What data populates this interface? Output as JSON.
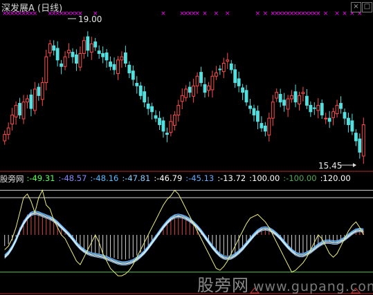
{
  "window": {
    "title": "深发展A (日线)",
    "buttons": [
      "×",
      "□"
    ]
  },
  "indicator_bar": {
    "name": "股旁网",
    "values": [
      {
        "text": ":-49.31",
        "color": "#55ff55"
      },
      {
        "text": ":-48.57",
        "color": "#8a8aff"
      },
      {
        "text": ":-48.16",
        "color": "#55bbff"
      },
      {
        "text": ":-47.81",
        "color": "#88ccff"
      },
      {
        "text": ":-46.79",
        "color": "#ffffff"
      },
      {
        "text": ":-45.13",
        "color": "#66aaff"
      },
      {
        "text": ":-13.72",
        "color": "#ffffff"
      },
      {
        "text": ":100.00",
        "color": "#ffffff"
      },
      {
        "text": ":-100.00",
        "color": "#55aa55"
      },
      {
        "text": ":120.00",
        "color": "#ffffff"
      }
    ]
  },
  "watermark": {
    "brand": "股旁网",
    "url": "www.gupang.com"
  },
  "annotations": {
    "high_label": "19.00",
    "low_label": "15.45"
  },
  "colors": {
    "up": "#ff4d4d",
    "down": "#55e0e0",
    "signal": "#ff00ff",
    "osc_white": "#ffffff",
    "osc_yellow": "#f0f080",
    "osc_blue": "#6fb4ff",
    "osc_cyan": "#8fdcff",
    "osc_green": "#55cc55",
    "bar_red": "#d84a4a",
    "bar_white": "#d8d8d8",
    "level_line": "#d8d8d8",
    "level_red": "#cc3333"
  },
  "chart_data": [
    {
      "type": "candlestick",
      "title": "深发展A (日线)",
      "series": [
        {
          "name": "close",
          "values": [
            16.0,
            16.2,
            16.6,
            16.9,
            16.6,
            17.0,
            17.1,
            16.8,
            17.4,
            17.2,
            17.6,
            18.4,
            18.8,
            18.6,
            18.3,
            18.1,
            18.4,
            18.6,
            18.4,
            18.2,
            18.5,
            18.9,
            18.6,
            18.8,
            18.7,
            18.5,
            18.4,
            18.3,
            18.1,
            18.0,
            18.3,
            18.4,
            18.2,
            17.9,
            17.7,
            17.5,
            17.2,
            17.0,
            16.8,
            16.7,
            16.5,
            16.3,
            16.1,
            16.0,
            16.4,
            16.6,
            16.9,
            17.2,
            17.4,
            17.3,
            17.5,
            17.8,
            17.6,
            17.3,
            17.5,
            17.8,
            17.9,
            18.0,
            18.2,
            18.3,
            18.0,
            17.6,
            17.5,
            17.3,
            17.0,
            16.8,
            16.6,
            16.4,
            16.2,
            16.1,
            16.5,
            17.0,
            17.3,
            17.0,
            16.9,
            17.1,
            17.2,
            17.0,
            17.2,
            17.3,
            16.9,
            16.7,
            16.8,
            16.9,
            16.6,
            16.5,
            16.4,
            16.7,
            16.9,
            16.8,
            16.5,
            16.3,
            16.1,
            15.8,
            15.45,
            16.3
          ]
        },
        {
          "name": "buy_signal_marks",
          "values": [
            1,
            1,
            1,
            1,
            1,
            1,
            1,
            1,
            1,
            0,
            0,
            0,
            1,
            1,
            1,
            1,
            1,
            1,
            1,
            1,
            1,
            0,
            0,
            0,
            1,
            0,
            0,
            0,
            0,
            0,
            0,
            0,
            0,
            0,
            0,
            0,
            0,
            0,
            0,
            0,
            0,
            0,
            1,
            0,
            0,
            0,
            0,
            1,
            1,
            1,
            1,
            1,
            0,
            1,
            0,
            0,
            1,
            0,
            0,
            1,
            0,
            0,
            0,
            0,
            0,
            0,
            0,
            1,
            0,
            1,
            0,
            1,
            1,
            1,
            1,
            1,
            1,
            1,
            1,
            1,
            1,
            1,
            1,
            1,
            0,
            1,
            0,
            0,
            1,
            0,
            1,
            0,
            1,
            0,
            1,
            0
          ]
        }
      ],
      "annotations": [
        {
          "text": "19.00",
          "type": "high"
        },
        {
          "text": "15.45",
          "type": "low"
        }
      ]
    },
    {
      "type": "line",
      "title": "股旁网",
      "levels": [
        100,
        -100,
        120
      ],
      "series": [
        {
          "name": "osc_fast",
          "values": [
            -40,
            -30,
            -10,
            20,
            60,
            100,
            110,
            90,
            60,
            100,
            120,
            80,
            70,
            40,
            20,
            0,
            -10,
            -30,
            -50,
            -70,
            -80,
            -60,
            -40,
            -20,
            0,
            -20,
            -50,
            -70,
            -90,
            -100,
            -110,
            -110,
            -105,
            -95,
            -80,
            -60,
            -40,
            -20,
            0,
            20,
            40,
            60,
            80,
            95,
            105,
            120,
            110,
            90,
            70,
            50,
            30,
            10,
            -10,
            -30,
            -50,
            -70,
            -90,
            -95,
            -85,
            -70,
            -50,
            -30,
            -10,
            10,
            30,
            45,
            50,
            55,
            45,
            35,
            20,
            0,
            -20,
            -40,
            -60,
            -80,
            -100,
            -95,
            -85,
            -75,
            -60,
            -40,
            -20,
            0,
            -10,
            -30,
            -50,
            -60,
            -50,
            -30,
            -10,
            10,
            25,
            35,
            20,
            0
          ]
        },
        {
          "name": "osc_smooth",
          "values": [
            -60,
            -50,
            -35,
            -15,
            10,
            30,
            45,
            55,
            58,
            56,
            52,
            48,
            44,
            38,
            30,
            20,
            10,
            0,
            -12,
            -25,
            -36,
            -44,
            -50,
            -54,
            -56,
            -58,
            -60,
            -64,
            -68,
            -72,
            -76,
            -78,
            -78,
            -76,
            -72,
            -66,
            -58,
            -48,
            -36,
            -22,
            -8,
            6,
            20,
            32,
            42,
            48,
            50,
            48,
            44,
            38,
            30,
            20,
            8,
            -6,
            -20,
            -34,
            -46,
            -56,
            -62,
            -64,
            -62,
            -56,
            -48,
            -38,
            -26,
            -14,
            -2,
            8,
            14,
            16,
            14,
            8,
            0,
            -10,
            -22,
            -34,
            -44,
            -52,
            -56,
            -56,
            -52,
            -46,
            -38,
            -30,
            -24,
            -20,
            -20,
            -22,
            -22,
            -18,
            -12,
            -4,
            4,
            10,
            12,
            10
          ]
        },
        {
          "name": "hist",
          "values": [
            -30,
            -25,
            -15,
            -5,
            20,
            40,
            55,
            60,
            58,
            55,
            50,
            45,
            40,
            35,
            25,
            15,
            5,
            -5,
            -15,
            -25,
            -35,
            -40,
            -45,
            -48,
            -50,
            -52,
            -55,
            -58,
            -60,
            -62,
            -65,
            -66,
            -66,
            -64,
            -60,
            -55,
            -48,
            -40,
            -30,
            -18,
            -5,
            8,
            20,
            30,
            40,
            45,
            48,
            46,
            42,
            36,
            28,
            18,
            6,
            -6,
            -18,
            -30,
            -40,
            -48,
            -54,
            -56,
            -54,
            -50,
            -44,
            -36,
            -26,
            -14,
            -2,
            8,
            14,
            16,
            14,
            8,
            0,
            -10,
            -22,
            -32,
            -40,
            -46,
            -50,
            -50,
            -46,
            -40,
            -34,
            -28,
            -22,
            -18,
            -18,
            -20,
            -20,
            -16,
            -10,
            -4,
            4,
            10,
            12,
            10
          ]
        }
      ]
    }
  ]
}
